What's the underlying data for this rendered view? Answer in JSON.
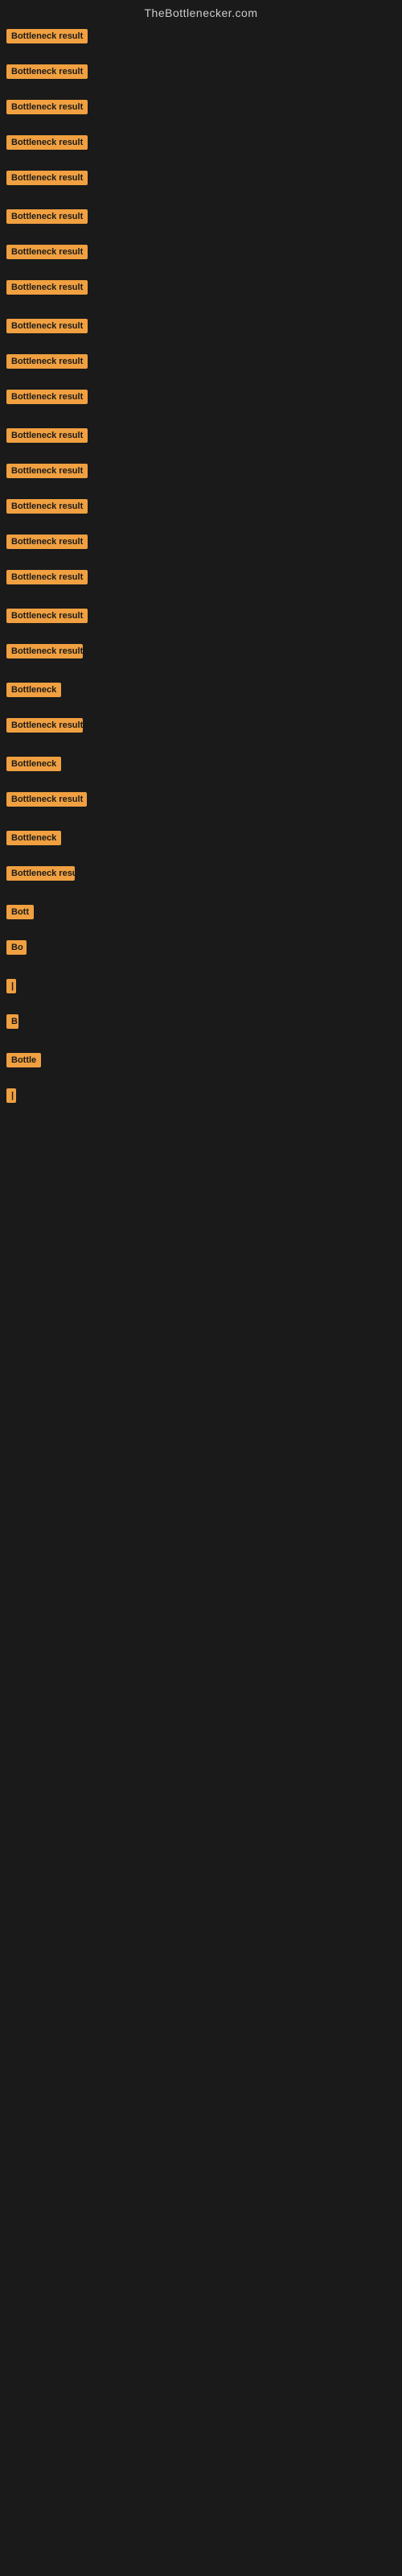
{
  "site": {
    "title": "TheBottlenecker.com"
  },
  "items": [
    {
      "id": 1,
      "label": "Bottleneck result",
      "width_class": "w-130",
      "spacing": 18
    },
    {
      "id": 2,
      "label": "Bottleneck result",
      "width_class": "w-130",
      "spacing": 18
    },
    {
      "id": 3,
      "label": "Bottleneck result",
      "width_class": "w-130",
      "spacing": 18
    },
    {
      "id": 4,
      "label": "Bottleneck result",
      "width_class": "w-130",
      "spacing": 18
    },
    {
      "id": 5,
      "label": "Bottleneck result",
      "width_class": "w-130",
      "spacing": 22
    },
    {
      "id": 6,
      "label": "Bottleneck result",
      "width_class": "w-130",
      "spacing": 18
    },
    {
      "id": 7,
      "label": "Bottleneck result",
      "width_class": "w-130",
      "spacing": 18
    },
    {
      "id": 8,
      "label": "Bottleneck result",
      "width_class": "w-130",
      "spacing": 22
    },
    {
      "id": 9,
      "label": "Bottleneck result",
      "width_class": "w-130",
      "spacing": 18
    },
    {
      "id": 10,
      "label": "Bottleneck result",
      "width_class": "w-130",
      "spacing": 18
    },
    {
      "id": 11,
      "label": "Bottleneck result",
      "width_class": "w-130",
      "spacing": 22
    },
    {
      "id": 12,
      "label": "Bottleneck result",
      "width_class": "w-125",
      "spacing": 18
    },
    {
      "id": 13,
      "label": "Bottleneck result",
      "width_class": "w-125",
      "spacing": 18
    },
    {
      "id": 14,
      "label": "Bottleneck result",
      "width_class": "w-120",
      "spacing": 18
    },
    {
      "id": 15,
      "label": "Bottleneck result",
      "width_class": "w-115",
      "spacing": 18
    },
    {
      "id": 16,
      "label": "Bottleneck result",
      "width_class": "w-110",
      "spacing": 22
    },
    {
      "id": 17,
      "label": "Bottleneck result",
      "width_class": "w-105",
      "spacing": 18
    },
    {
      "id": 18,
      "label": "Bottleneck result",
      "width_class": "w-95",
      "spacing": 22
    },
    {
      "id": 19,
      "label": "Bottleneck",
      "width_class": "w-80",
      "spacing": 18
    },
    {
      "id": 20,
      "label": "Bottleneck result",
      "width_class": "w-95",
      "spacing": 22
    },
    {
      "id": 21,
      "label": "Bottleneck",
      "width_class": "w-75",
      "spacing": 18
    },
    {
      "id": 22,
      "label": "Bottleneck result",
      "width_class": "w-100",
      "spacing": 22
    },
    {
      "id": 23,
      "label": "Bottleneck",
      "width_class": "w-70",
      "spacing": 18
    },
    {
      "id": 24,
      "label": "Bottleneck result",
      "width_class": "w-85",
      "spacing": 22
    },
    {
      "id": 25,
      "label": "Bott",
      "width_class": "w-40",
      "spacing": 18
    },
    {
      "id": 26,
      "label": "Bo",
      "width_class": "w-25",
      "spacing": 22
    },
    {
      "id": 27,
      "label": "|",
      "width_class": "w-10",
      "spacing": 18
    },
    {
      "id": 28,
      "label": "B",
      "width_class": "w-15",
      "spacing": 22
    },
    {
      "id": 29,
      "label": "Bottle",
      "width_class": "w-50",
      "spacing": 18
    },
    {
      "id": 30,
      "label": "|",
      "width_class": "w-10",
      "spacing": 22
    }
  ],
  "colors": {
    "badge_bg": "#f0a040",
    "badge_text": "#1a1a1a",
    "background": "#1a1a1a",
    "title_text": "#cccccc"
  }
}
